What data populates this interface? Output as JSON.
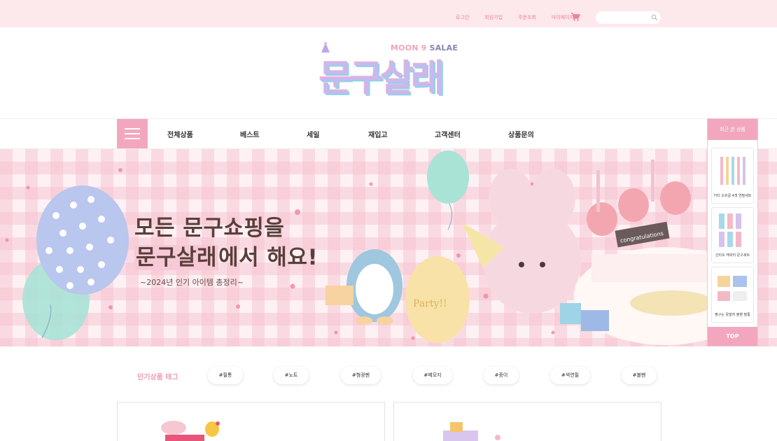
{
  "topbar": {
    "links": [
      "로그인",
      "회원가입",
      "주문조회",
      "마이페이지"
    ],
    "cart_icon": "cart-icon",
    "search": {
      "placeholder": "",
      "icon": "search-icon"
    },
    "colors": {
      "bg": "#fde8ec",
      "link": "#e7849a"
    }
  },
  "logo": {
    "sub_moon": "MOON 9",
    "sub_salae": "SALAE",
    "main": "문구살래"
  },
  "nav": {
    "menu_icon": "hamburger-icon",
    "items": [
      "전체상품",
      "베스트",
      "세일",
      "재입고",
      "고객센터",
      "상품문의"
    ],
    "accent": "#f3a7bf"
  },
  "hero": {
    "line1": "모든 문구쇼핑을",
    "line2_highlight": "문구살래",
    "line2_rest": "에서 해요!",
    "subtitle": "~2024년 인기 아이템 총정리~",
    "balloon_text": "Party!!",
    "cake_plaque": "congratulations"
  },
  "recent": {
    "title": "최근 본 상품",
    "items": [
      {
        "caption": "키티 오르골 4색 연필세트"
      },
      {
        "caption": "산리오 캐릭터 문구세트"
      },
      {
        "caption": "짱구는 못말려 볼펜 필통"
      }
    ],
    "top_label": "TOP"
  },
  "tags": {
    "label": "인기상품 태그",
    "items": [
      "#필통",
      "#노트",
      "#형광펜",
      "#메모지",
      "#종이",
      "#색연필",
      "#볼펜"
    ]
  }
}
